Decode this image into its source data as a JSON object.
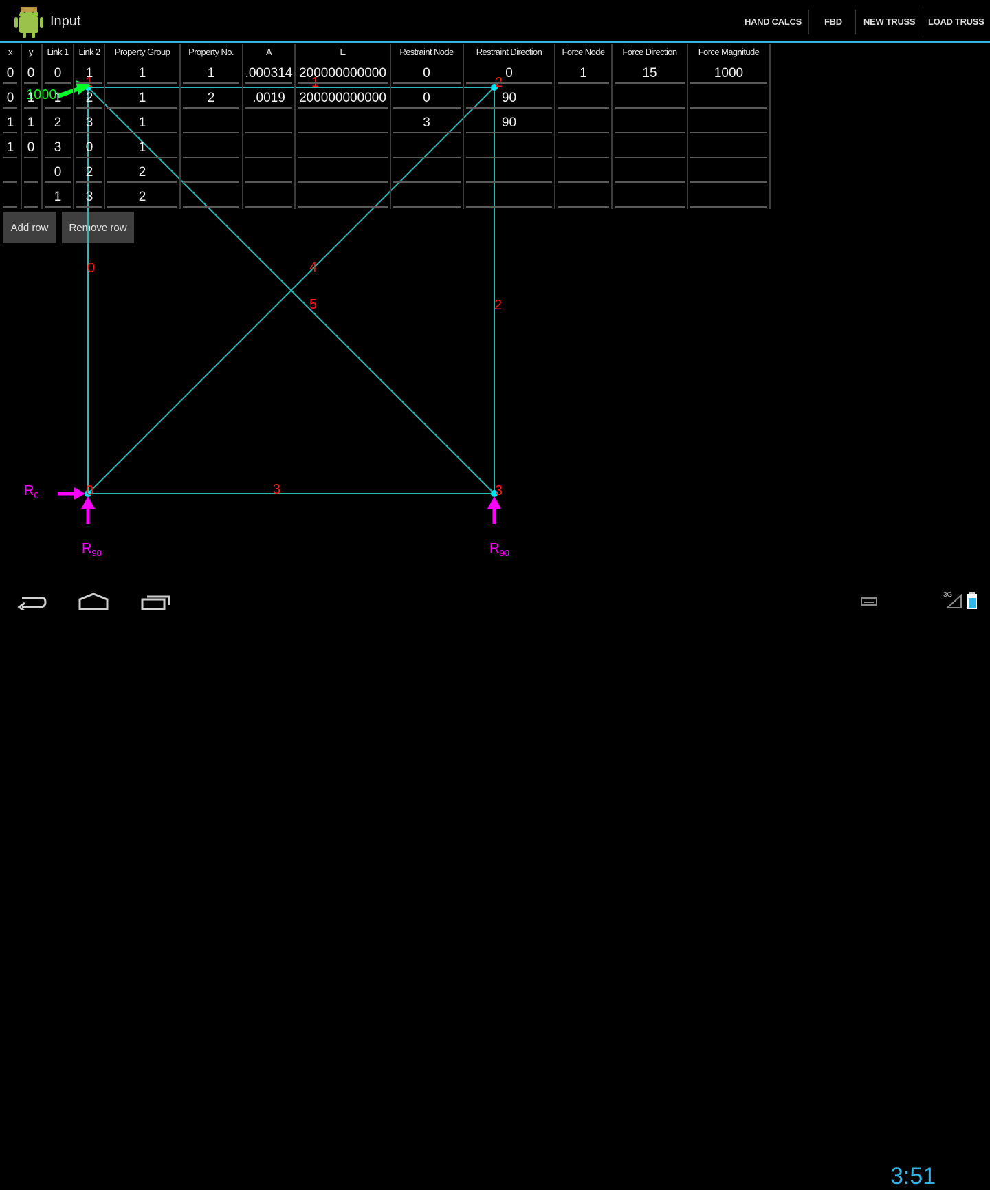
{
  "app": {
    "title": "Input"
  },
  "actions": [
    "HAND CALCS",
    "FBD",
    "NEW TRUSS",
    "LOAD TRUSS"
  ],
  "table": {
    "headers": [
      "x",
      "y",
      "Link 1",
      "Link 2",
      "Property Group",
      "Property No.",
      "A",
      "E",
      "Restraint Node",
      "Restraint Direction",
      "Force Node",
      "Force Direction",
      "Force Magnitude"
    ],
    "rows": [
      [
        "0",
        "0",
        "0",
        "1",
        "1",
        "1",
        ".000314",
        "200000000000",
        "0",
        "0",
        "1",
        "15",
        "1000"
      ],
      [
        "0",
        "1",
        "1",
        "2",
        "1",
        "2",
        ".0019",
        "200000000000",
        "0",
        "90",
        "",
        "",
        ""
      ],
      [
        "1",
        "1",
        "2",
        "3",
        "1",
        "",
        "",
        "",
        "3",
        "90",
        "",
        "",
        ""
      ],
      [
        "1",
        "0",
        "3",
        "0",
        "1",
        "",
        "",
        "",
        "",
        "",
        "",
        "",
        ""
      ],
      [
        "",
        "",
        "0",
        "2",
        "2",
        "",
        "",
        "",
        "",
        "",
        "",
        "",
        ""
      ],
      [
        "",
        "",
        "1",
        "3",
        "2",
        "",
        "",
        "",
        "",
        "",
        "",
        "",
        ""
      ]
    ]
  },
  "buttons": {
    "add_row": "Add row",
    "remove_row": "Remove row"
  },
  "truss": {
    "node_labels": [
      "0",
      "1",
      "2",
      "3"
    ],
    "member_labels": [
      "0",
      "1",
      "2",
      "3",
      "4",
      "5"
    ],
    "force_label": "1000",
    "reactions": [
      "R0",
      "R90",
      "R90"
    ],
    "colors": {
      "member": "#2bb7b3",
      "label": "#ff1a1a",
      "force": "#00ff2a",
      "reaction": "#ff00ff",
      "node": "#00e5ff",
      "accent": "#33b5e5"
    }
  },
  "status": {
    "time": "3:51",
    "signal": "3G"
  },
  "icons": [
    "android-app-icon",
    "back-icon",
    "home-icon",
    "recent-apps-icon",
    "keyboard-icon",
    "signal-icon",
    "battery-icon"
  ]
}
